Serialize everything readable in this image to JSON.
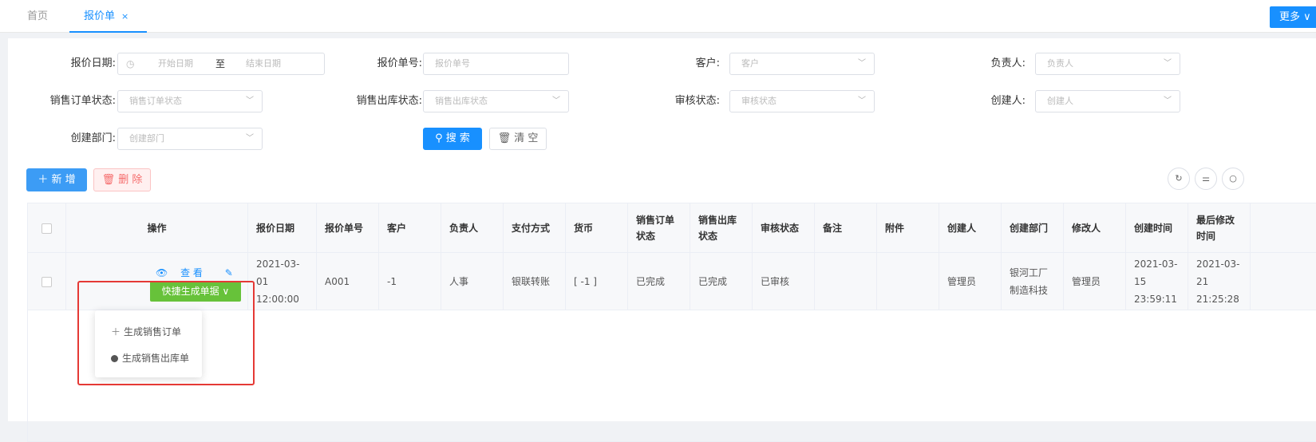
{
  "tabs": {
    "home": "首页",
    "active": "报价单",
    "close": "×"
  },
  "more": "更多",
  "filters": {
    "quote_date_label": "报价日期:",
    "start_date_placeholder": "开始日期",
    "date_separator": "至",
    "end_date_placeholder": "结束日期",
    "quote_no_label": "报价单号:",
    "quote_no_placeholder": "报价单号",
    "customer_label": "客户:",
    "customer_placeholder": "客户",
    "owner_label": "负责人:",
    "owner_placeholder": "负责人",
    "so_status_label": "销售订单状态:",
    "so_status_placeholder": "销售订单状态",
    "out_status_label": "销售出库状态:",
    "out_status_placeholder": "销售出库状态",
    "audit_label": "审核状态:",
    "audit_placeholder": "审核状态",
    "creator_label": "创建人:",
    "creator_placeholder": "创建人",
    "dept_label": "创建部门:",
    "dept_placeholder": "创建部门"
  },
  "buttons": {
    "search": "搜 索",
    "clear": "清 空",
    "add": "新 增",
    "delete": "删 除"
  },
  "table": {
    "headers": [
      "操作",
      "报价日期",
      "报价单号",
      "客户",
      "负责人",
      "支付方式",
      "货币",
      "销售订单状态",
      "销售出库状态",
      "审核状态",
      "备注",
      "附件",
      "创建人",
      "创建部门",
      "修改人",
      "创建时间",
      "最后修改时间"
    ],
    "row": {
      "view": "查 看",
      "edit": "编 辑",
      "quick": "快捷生成单据",
      "date": "2021-03-01 12:00:00",
      "no": "A001",
      "customer": "-1",
      "owner": "人事",
      "pay": "银联转账",
      "currency": "[ -1 ]",
      "so_status": "已完成",
      "out_status": "已完成",
      "audit": "已审核",
      "remark": "",
      "attach": "",
      "creator": "管理员",
      "dept": "银河工厂制造科技",
      "modifier": "管理员",
      "created": "2021-03-15 23:59:11",
      "modified": "2021-03-21 21:25:28"
    }
  },
  "dropdown": {
    "item1": "生成销售订单",
    "item2": "生成销售出库单"
  }
}
